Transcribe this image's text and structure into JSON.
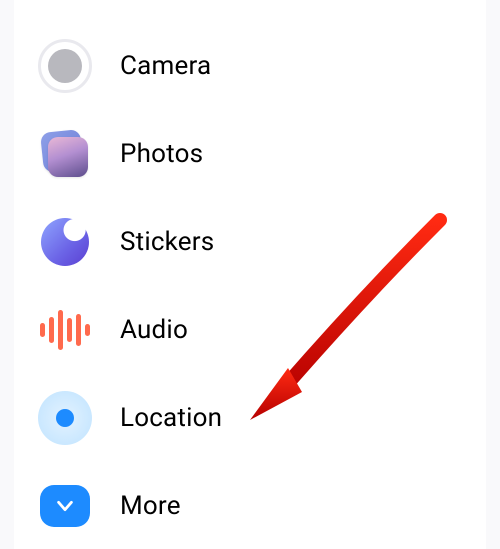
{
  "menu": {
    "items": [
      {
        "label": "Camera",
        "icon": "camera-icon"
      },
      {
        "label": "Photos",
        "icon": "photos-icon"
      },
      {
        "label": "Stickers",
        "icon": "stickers-icon"
      },
      {
        "label": "Audio",
        "icon": "audio-icon"
      },
      {
        "label": "Location",
        "icon": "location-icon"
      },
      {
        "label": "More",
        "icon": "more-icon"
      }
    ]
  },
  "annotation": {
    "type": "arrow",
    "target": "location-menu-item",
    "color": "#d40202"
  }
}
